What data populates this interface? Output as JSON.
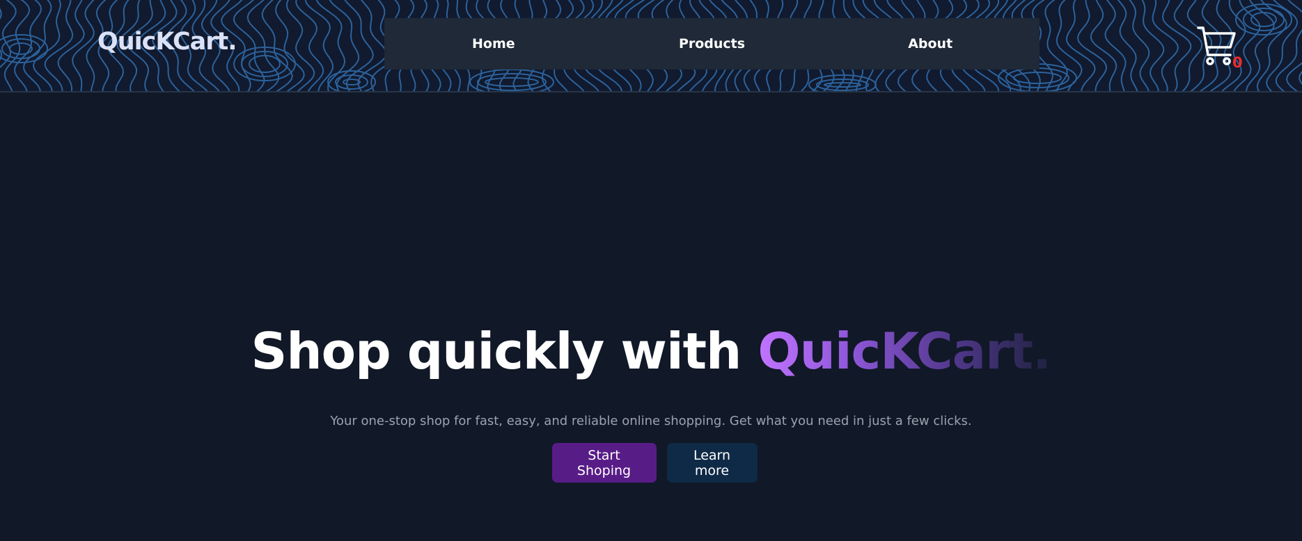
{
  "header": {
    "logo": "QuicKCart.",
    "nav": [
      {
        "label": "Home"
      },
      {
        "label": "Products"
      },
      {
        "label": "About"
      }
    ],
    "cart": {
      "icon": "shopping-cart-icon",
      "count": "0"
    }
  },
  "hero": {
    "title_prefix": "Shop quickly with ",
    "title_brand": "QuicKCart.",
    "subtitle": "Your one-stop shop for fast, easy, and reliable online shopping. Get what you need in just a few clicks.",
    "primary_button": "Start Shoping",
    "secondary_button": "Learn more"
  },
  "colors": {
    "background": "#111827",
    "nav_background": "#1f2937",
    "pattern_lines": "#2f6aa8",
    "primary_button": "#581c87",
    "secondary_button": "#0f2a46",
    "cart_count": "#ef2b2b",
    "brand_gradient_start": "#c174ff"
  }
}
